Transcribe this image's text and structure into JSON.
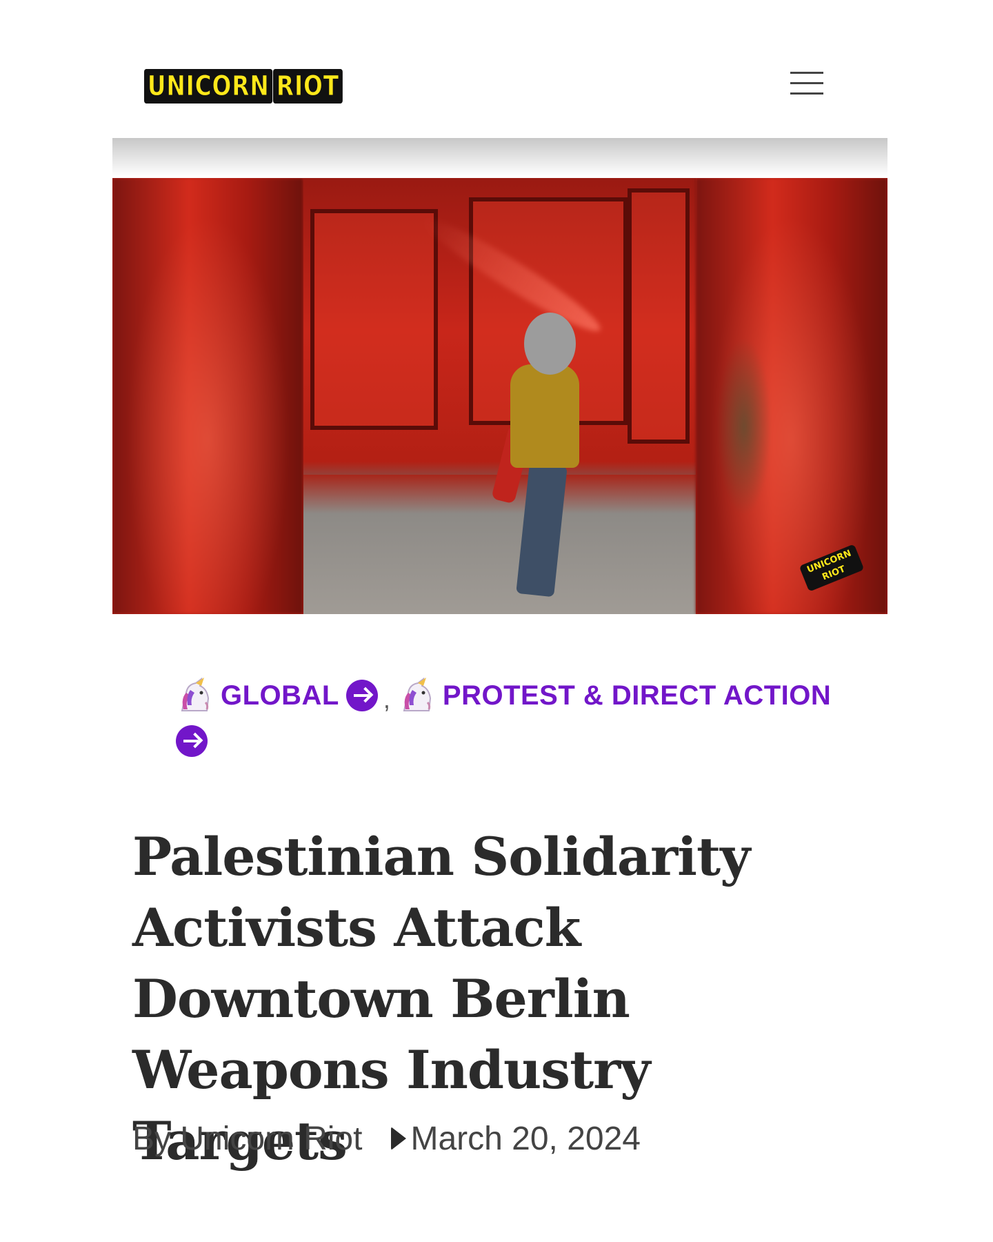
{
  "header": {
    "logo_word_1": "UNICORN",
    "logo_word_2": "RIOT",
    "menu_icon": "hamburger-menu-icon"
  },
  "hero": {
    "watermark_line_1": "UNICORN",
    "watermark_line_2": "RIOT"
  },
  "categories": [
    {
      "label": "GLOBAL",
      "icon": "unicorn-emoji-icon",
      "arrow": "arrow-right-circle-icon"
    },
    {
      "label": "PROTEST & DIRECT ACTION",
      "icon": "unicorn-emoji-icon",
      "arrow": "arrow-right-circle-icon"
    }
  ],
  "category_separator": ",",
  "post": {
    "title": "Palestinian Solidarity Activists Attack Downtown Berlin Weapons Industry Targets",
    "author": "By Unicorn Riot",
    "date": "March 20, 2024"
  },
  "colors": {
    "accent_purple": "#7216c9",
    "logo_yellow": "#ffe81a",
    "paint_red": "#c8261a"
  }
}
